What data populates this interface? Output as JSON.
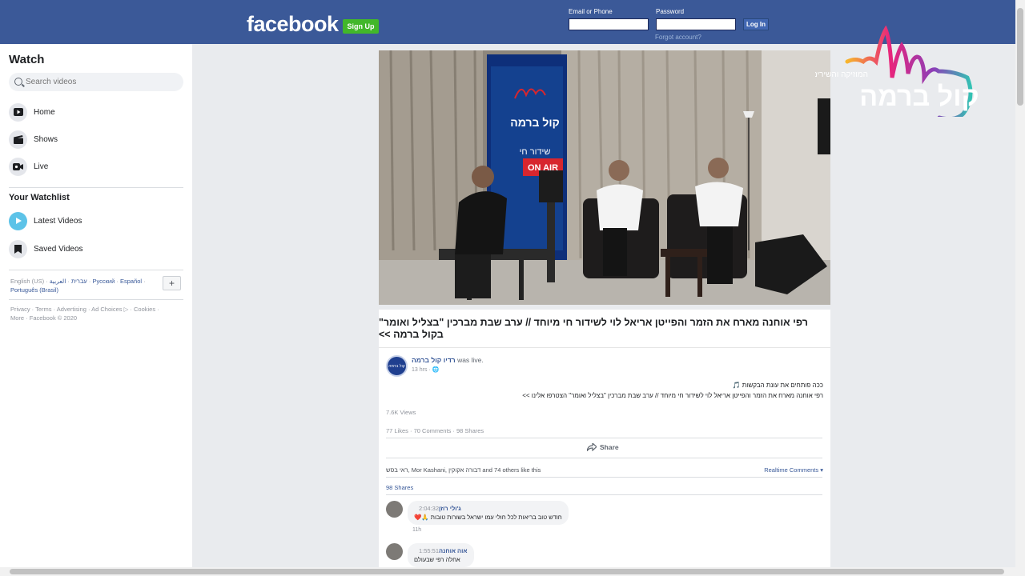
{
  "header": {
    "logo": "facebook",
    "signup_label": "Sign Up",
    "email_label": "Email or Phone",
    "password_label": "Password",
    "login_label": "Log In",
    "forgot_label": "Forgot account?"
  },
  "sidebar": {
    "title": "Watch",
    "search_placeholder": "Search videos",
    "nav": [
      {
        "label": "Home",
        "icon": "play-icon"
      },
      {
        "label": "Shows",
        "icon": "clapperboard-icon"
      },
      {
        "label": "Live",
        "icon": "live-camera-icon"
      }
    ],
    "watchlist_title": "Your Watchlist",
    "watchlist": [
      {
        "label": "Latest Videos",
        "icon": "play-circle-icon"
      },
      {
        "label": "Saved Videos",
        "icon": "bookmark-icon"
      }
    ],
    "languages": [
      "English (US)",
      "עברית",
      "العربية",
      "Русский",
      "Español",
      "Português (Brasil)"
    ],
    "plus_label": "+",
    "footer": "Privacy · Terms · Advertising · Ad Choices ▷ · Cookies · More · Facebook © 2020"
  },
  "video": {
    "watermark_top": "המוזיקה והשירים",
    "watermark_main": "קול ברמה",
    "banner_name": "קול ברמה",
    "banner_live": "שידור חי",
    "banner_onair": "ON AIR"
  },
  "post": {
    "title": "רפי אוחנה מארח את הזמר והפייטן אריאל לוי לשידור חי מיוחד // ערב שבת מברכין \"בצליל ואומר\" בקול ברמה >>",
    "page_name": "רדיו קול ברמה",
    "was_live": "was live.",
    "time": "13 hrs",
    "text_line1": "ככה פותחים את עונת הבקשות 🎵",
    "text_line2": "רפי אוחנה מארח את הזמר והפייטן אריאל לוי לשידור חי מיוחד // ערב שבת מברכין \"בצליל ואומר\" הצטרפו אלינו >>",
    "views": "7.6K Views",
    "likes": "77 Likes",
    "comments": "70 Comments",
    "shares": "98 Shares",
    "share_label": "Share",
    "likers": "ראי בסש, Mor Kashani, דבורה אקוקין and 74 others like this",
    "realtime_label": "Realtime Comments ▾",
    "shares_link": "98 Shares"
  },
  "comments": [
    {
      "name": "ג'ולי רוזן",
      "time": "2:04:32",
      "text": "חודש טוב בריאות לכל חולי עמו ישראל בשורות טובות 🙏❤️",
      "meta": "11h"
    },
    {
      "name": "אוה אוחנה",
      "time": "1:55:51",
      "text": "אחלה רפי שבעולם",
      "meta": ""
    }
  ],
  "colors": {
    "brand": "#3b5998",
    "signup": "#42b72a",
    "link": "#385898",
    "onair": "#d7262e"
  }
}
